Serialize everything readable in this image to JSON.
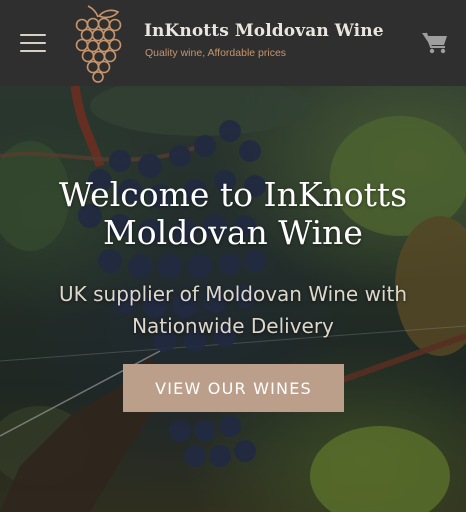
{
  "header": {
    "brand_title": "InKnotts Moldovan Wine",
    "tagline": "Quality wine, Affordable prices",
    "menu_icon": "hamburger-menu-icon",
    "cart_icon": "shopping-cart-icon",
    "logo_icon": "grape-cluster-logo"
  },
  "hero": {
    "title": "Welcome to InKnotts Moldovan Wine",
    "subtitle": "UK supplier of Moldovan Wine with Nationwide Delivery",
    "cta_label": "VIEW OUR WINES"
  },
  "colors": {
    "header_bg": "#2f2f2f",
    "accent": "#c7956b",
    "cta_bg": "#bb9f8a",
    "text_light": "#eae6df"
  }
}
